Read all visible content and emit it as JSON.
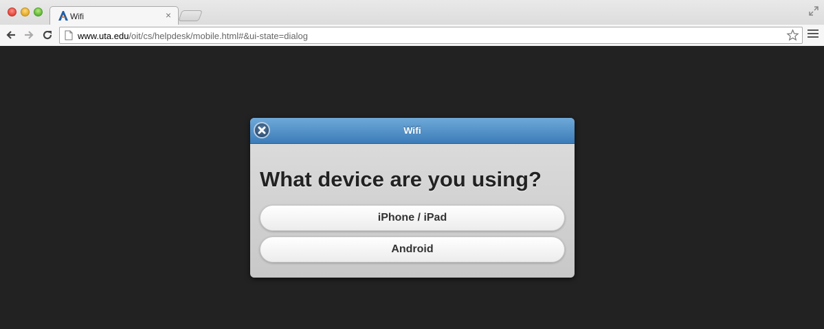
{
  "browser": {
    "tab": {
      "title": "Wifi"
    },
    "address_bar": {
      "url_host": "www.uta.edu",
      "url_path": "/oit/cs/helpdesk/mobile.html#&ui-state=dialog"
    },
    "icons": {
      "back": "back-arrow-icon",
      "forward": "forward-arrow-icon",
      "reload": "reload-icon",
      "bookmark": "star-icon",
      "menu": "hamburger-menu-icon",
      "fullscreen": "fullscreen-icon",
      "favicon": "uta-logo-icon",
      "page": "page-icon"
    },
    "tab_close": "×"
  },
  "dialog": {
    "title": "Wifi",
    "question": "What device are you using?",
    "options": [
      {
        "label": "iPhone / iPad"
      },
      {
        "label": "Android"
      }
    ],
    "header_color": "#4a8ac6"
  }
}
